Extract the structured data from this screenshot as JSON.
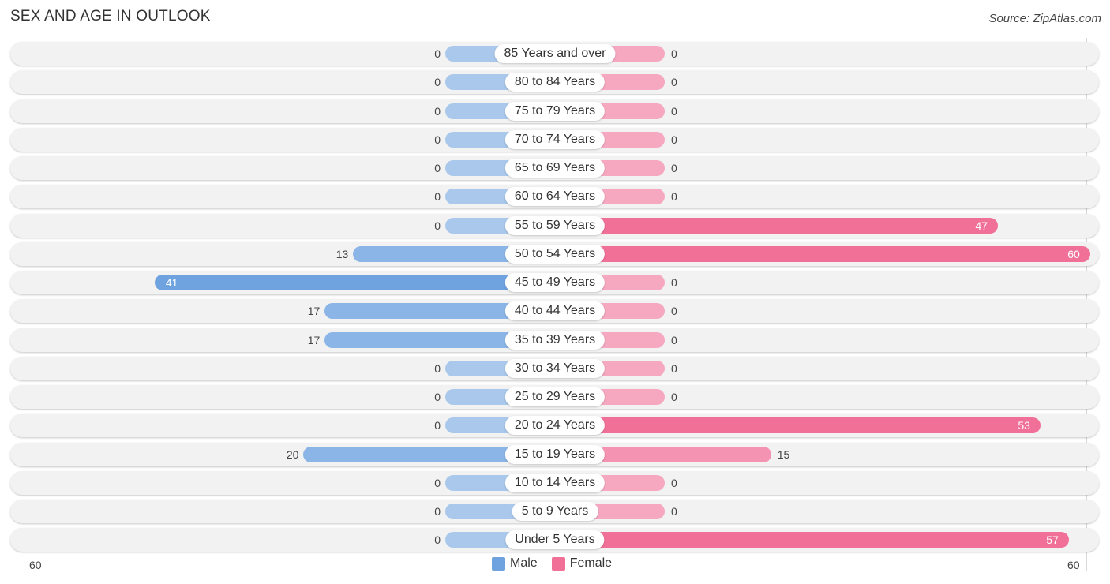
{
  "header": {
    "title": "SEX AND AGE IN OUTLOOK",
    "source": "Source: ZipAtlas.com"
  },
  "colors": {
    "male": "#6fa3e0",
    "male_light": "#a9c8eb",
    "female": "#f07098",
    "female_light": "#f5a8c0"
  },
  "chart_data": {
    "type": "bar",
    "orientation": "horizontal-diverging",
    "title": "SEX AND AGE IN OUTLOOK",
    "categories": [
      "85 Years and over",
      "80 to 84 Years",
      "75 to 79 Years",
      "70 to 74 Years",
      "65 to 69 Years",
      "60 to 64 Years",
      "55 to 59 Years",
      "50 to 54 Years",
      "45 to 49 Years",
      "40 to 44 Years",
      "35 to 39 Years",
      "30 to 34 Years",
      "25 to 29 Years",
      "20 to 24 Years",
      "15 to 19 Years",
      "10 to 14 Years",
      "5 to 9 Years",
      "Under 5 Years"
    ],
    "series": [
      {
        "name": "Male",
        "values": [
          0,
          0,
          0,
          0,
          0,
          0,
          0,
          13,
          41,
          17,
          17,
          0,
          0,
          0,
          20,
          0,
          0,
          0
        ]
      },
      {
        "name": "Female",
        "values": [
          0,
          0,
          0,
          0,
          0,
          0,
          47,
          60,
          0,
          0,
          0,
          0,
          0,
          53,
          15,
          0,
          0,
          57
        ]
      }
    ],
    "xlim": [
      -60,
      60
    ],
    "axis_tick_labels": {
      "left": "60",
      "right": "60"
    },
    "legend": {
      "position": "bottom-center",
      "entries": [
        "Male",
        "Female"
      ]
    },
    "grid": false
  }
}
